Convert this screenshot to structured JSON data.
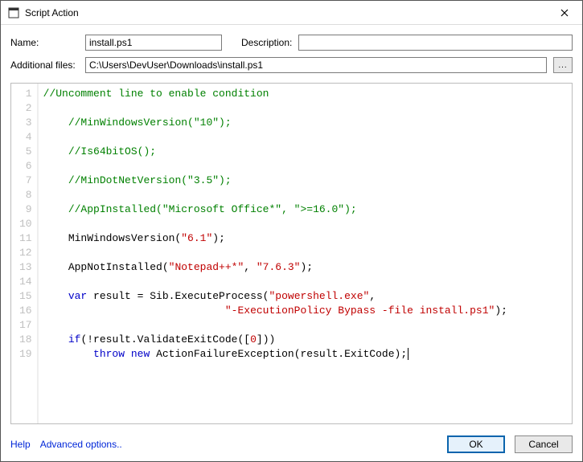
{
  "window": {
    "title": "Script Action"
  },
  "fields": {
    "name_label": "Name:",
    "name_value": "install.ps1",
    "desc_label": "Description:",
    "desc_value": "",
    "addfiles_label": "Additional files:",
    "addfiles_value": "C:\\Users\\DevUser\\Downloads\\install.ps1",
    "browse_dots": "..."
  },
  "code": {
    "lines": [
      [
        {
          "t": "//Uncomment line to enable condition",
          "c": "c-comment"
        }
      ],
      [],
      [
        {
          "t": "    ",
          "c": ""
        },
        {
          "t": "//MinWindowsVersion(\"10\");",
          "c": "c-comment"
        }
      ],
      [],
      [
        {
          "t": "    ",
          "c": ""
        },
        {
          "t": "//Is64bitOS();",
          "c": "c-comment"
        }
      ],
      [],
      [
        {
          "t": "    ",
          "c": ""
        },
        {
          "t": "//MinDotNetVersion(\"3.5\");",
          "c": "c-comment"
        }
      ],
      [],
      [
        {
          "t": "    ",
          "c": ""
        },
        {
          "t": "//AppInstalled(\"Microsoft Office*\", \">=16.0\");",
          "c": "c-comment"
        }
      ],
      [],
      [
        {
          "t": "    MinWindowsVersion(",
          "c": "c-ident"
        },
        {
          "t": "\"6.1\"",
          "c": "c-str"
        },
        {
          "t": ");",
          "c": "c-ident"
        }
      ],
      [],
      [
        {
          "t": "    AppNotInstalled(",
          "c": "c-ident"
        },
        {
          "t": "\"Notepad++*\"",
          "c": "c-str"
        },
        {
          "t": ", ",
          "c": "c-ident"
        },
        {
          "t": "\"7.6.3\"",
          "c": "c-str"
        },
        {
          "t": ");",
          "c": "c-ident"
        }
      ],
      [],
      [
        {
          "t": "    ",
          "c": ""
        },
        {
          "t": "var",
          "c": "c-kw"
        },
        {
          "t": " result = Sib.ExecuteProcess(",
          "c": "c-ident"
        },
        {
          "t": "\"powershell.exe\"",
          "c": "c-str"
        },
        {
          "t": ",",
          "c": "c-ident"
        }
      ],
      [
        {
          "t": "                             ",
          "c": ""
        },
        {
          "t": "\"-ExecutionPolicy Bypass -file install.ps1\"",
          "c": "c-str"
        },
        {
          "t": ");",
          "c": "c-ident"
        }
      ],
      [],
      [
        {
          "t": "    ",
          "c": ""
        },
        {
          "t": "if",
          "c": "c-kw"
        },
        {
          "t": "(!result.ValidateExitCode([",
          "c": "c-ident"
        },
        {
          "t": "0",
          "c": "c-num"
        },
        {
          "t": "]))",
          "c": "c-ident"
        }
      ],
      [
        {
          "t": "        ",
          "c": ""
        },
        {
          "t": "throw",
          "c": "c-kw"
        },
        {
          "t": " ",
          "c": ""
        },
        {
          "t": "new",
          "c": "c-kw"
        },
        {
          "t": " ActionFailureException(result.ExitCode);",
          "c": "c-ident"
        },
        {
          "t": "",
          "c": "caret"
        }
      ]
    ]
  },
  "footer": {
    "help": "Help",
    "advanced": "Advanced options..",
    "ok": "OK",
    "cancel": "Cancel"
  }
}
